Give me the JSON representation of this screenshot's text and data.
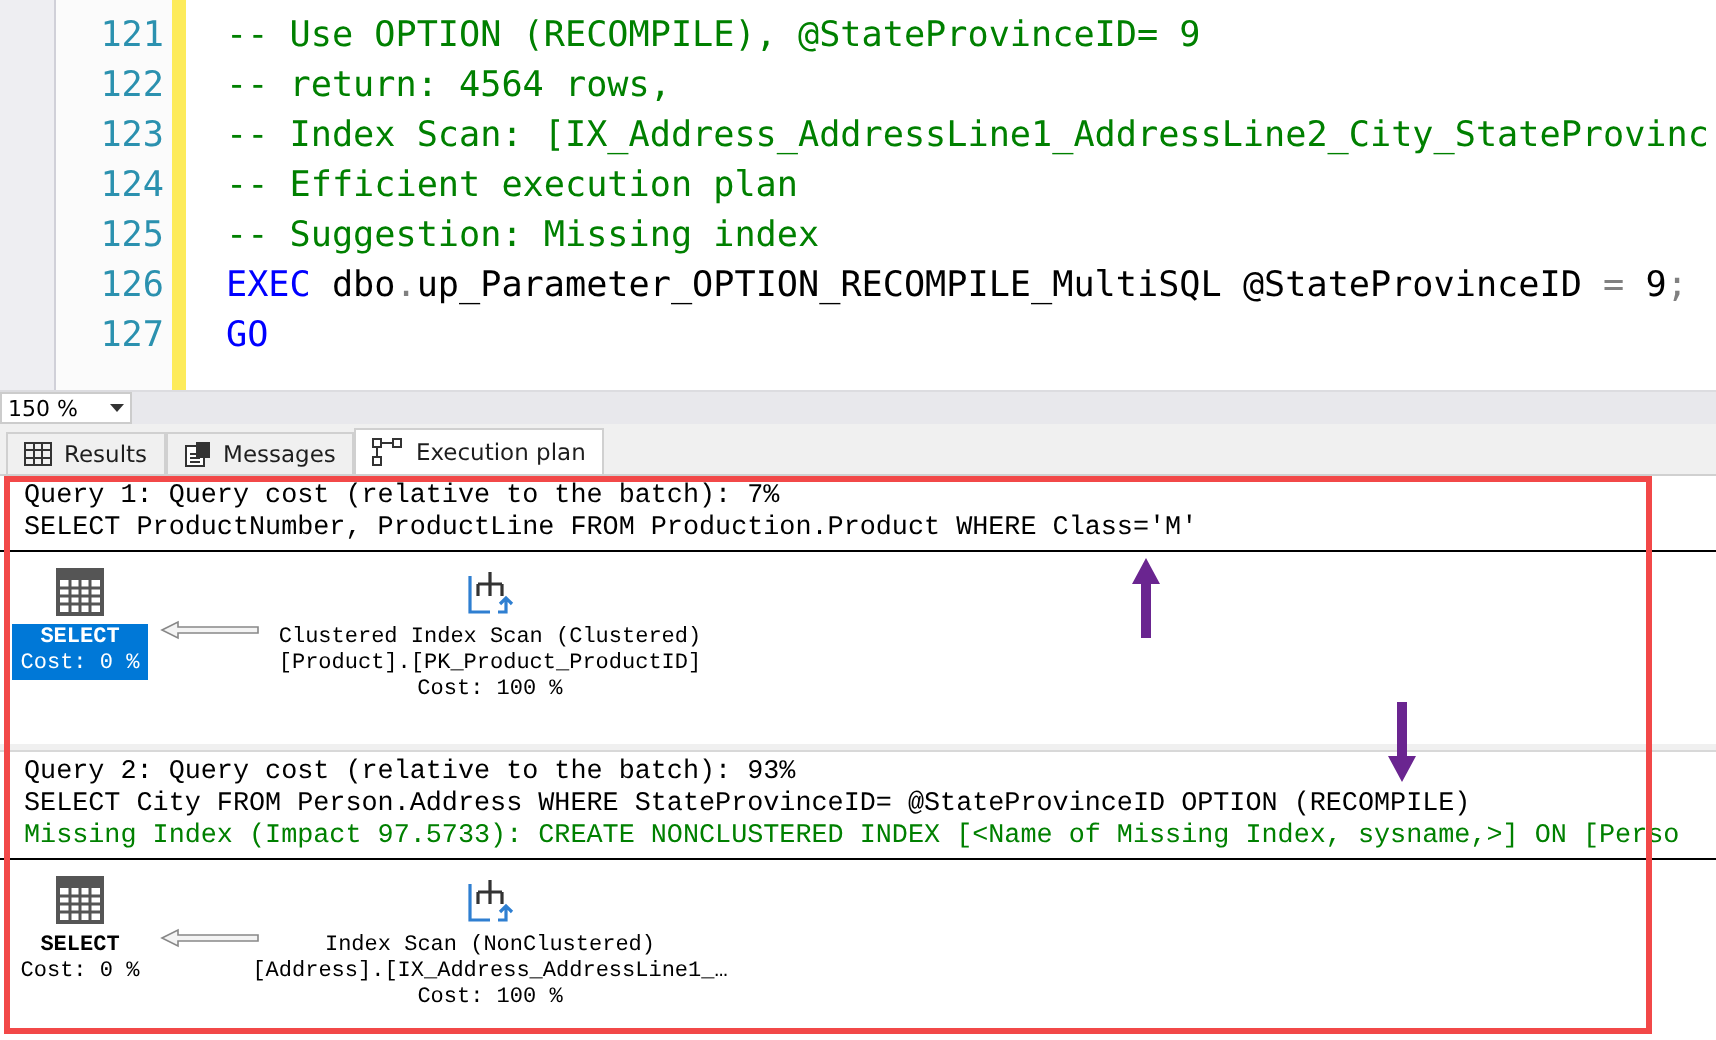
{
  "editor": {
    "lines": [
      {
        "number": "121",
        "segments": [
          {
            "kind": "comment",
            "text": "-- Use OPTION (RECOMPILE), @StateProvinceID= 9"
          }
        ]
      },
      {
        "number": "122",
        "segments": [
          {
            "kind": "comment",
            "text": "-- return: 4564 rows,"
          }
        ]
      },
      {
        "number": "123",
        "segments": [
          {
            "kind": "comment",
            "text": "-- Index Scan: [IX_Address_AddressLine1_AddressLine2_City_StateProvinc"
          }
        ]
      },
      {
        "number": "124",
        "segments": [
          {
            "kind": "comment",
            "text": "-- Efficient execution plan"
          }
        ]
      },
      {
        "number": "125",
        "segments": [
          {
            "kind": "comment",
            "text": "-- Suggestion: Missing index"
          }
        ]
      },
      {
        "number": "126",
        "segments": [
          {
            "kind": "keyword",
            "text": "EXEC "
          },
          {
            "kind": "plain",
            "text": "dbo"
          },
          {
            "kind": "operator",
            "text": "."
          },
          {
            "kind": "plain",
            "text": "up_Parameter_OPTION_RECOMPILE_MultiSQL @StateProvinceID "
          },
          {
            "kind": "operator",
            "text": "= "
          },
          {
            "kind": "plain",
            "text": "9"
          },
          {
            "kind": "operator",
            "text": ";"
          }
        ]
      },
      {
        "number": "127",
        "segments": [
          {
            "kind": "keyword",
            "text": "GO"
          }
        ]
      }
    ]
  },
  "zoom": "150 %",
  "tabs": [
    {
      "label": "Results",
      "kind": "grid",
      "selected": false
    },
    {
      "label": "Messages",
      "kind": "messages",
      "selected": false
    },
    {
      "label": "Execution plan",
      "kind": "plan",
      "selected": true
    }
  ],
  "queries": [
    {
      "header": "Query 1: Query cost (relative to the batch): 7%",
      "statement": "SELECT ProductNumber, ProductLine FROM Production.Product WHERE Class='M'",
      "nodes": [
        {
          "kind": "select",
          "lines": [
            "SELECT",
            "Cost: 0 %"
          ],
          "selected": true
        },
        {
          "kind": "scan",
          "lines": [
            "Clustered Index Scan (Clustered)",
            "[Product].[PK_Product_ProductID]",
            "Cost: 100 %"
          ],
          "selected": false
        }
      ]
    },
    {
      "header": "Query 2: Query cost (relative to the batch): 93%",
      "statement": "SELECT City FROM Person.Address WHERE StateProvinceID= @StateProvinceID OPTION (RECOMPILE)",
      "missing_index": "Missing Index (Impact 97.5733): CREATE NONCLUSTERED INDEX [<Name of Missing Index, sysname,>] ON [Perso",
      "nodes": [
        {
          "kind": "select",
          "lines": [
            "SELECT",
            "Cost: 0 %"
          ],
          "selected": false
        },
        {
          "kind": "scan",
          "lines": [
            "Index Scan (NonClustered)",
            "[Address].[IX_Address_AddressLine1_…",
            "Cost: 100 %"
          ],
          "selected": false
        }
      ]
    }
  ]
}
